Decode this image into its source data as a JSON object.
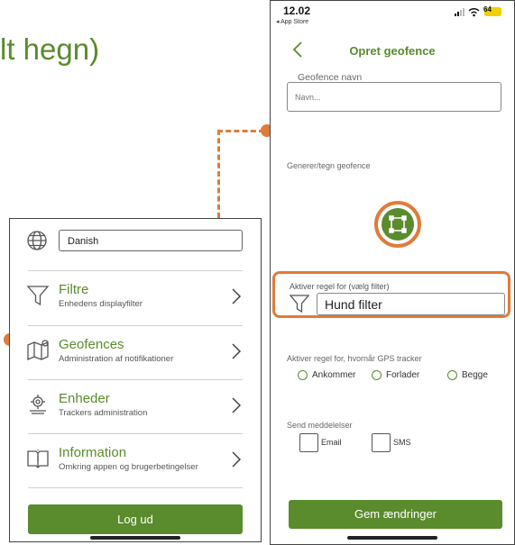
{
  "background_heading_fragment": "lt hegn)",
  "colors": {
    "brand_green": "#5a8b2c",
    "accent_orange": "#e07b39"
  },
  "left_screen": {
    "language_value": "Danish",
    "menu": [
      {
        "title": "Filtre",
        "subtitle": "Enhedens displayfilter",
        "icon": "filter-icon"
      },
      {
        "title": "Geofences",
        "subtitle": "Administration af notifikationer",
        "icon": "map-icon"
      },
      {
        "title": "Enheder",
        "subtitle": "Trackers administration",
        "icon": "device-icon"
      },
      {
        "title": "Information",
        "subtitle": "Omkring appen og brugerbetingelser",
        "icon": "info-book-icon"
      }
    ],
    "logout_label": "Log ud"
  },
  "right_screen": {
    "status": {
      "time": "12.02",
      "back_app": "◂ App Store",
      "battery": "64"
    },
    "title": "Opret geofence",
    "name_label": "Geofence navn",
    "name_placeholder": "Navn...",
    "draw_label": "Generer/tegn geofence",
    "rule_filter_label": "Aktiver regel for (vælg filter)",
    "rule_filter_value": "Hund filter",
    "trigger_label": "Aktiver regel for, hvornår GPS tracker",
    "trigger_options": [
      "Ankommer",
      "Forlader",
      "Begge"
    ],
    "notify_label": "Send meddelelser",
    "notify_options": [
      "Email",
      "SMS"
    ],
    "save_label": "Gem ændringer"
  }
}
